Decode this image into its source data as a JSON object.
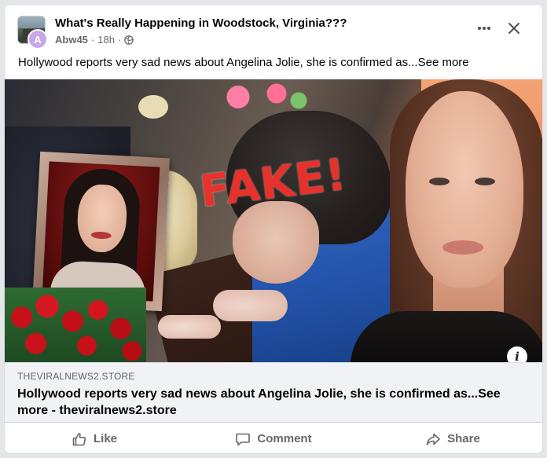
{
  "post": {
    "group_name": "What's Really Happening in Woodstock, Virginia???",
    "author_initial": "A",
    "author": "Abw45",
    "time": "18h",
    "separator": "·",
    "text": "Hollywood reports very sad news about Angelina Jolie, she is confirmed as...",
    "see_more": "See more"
  },
  "link_preview": {
    "stamp_text": "FAKE!",
    "domain": "THEVIRALNEWS2.STORE",
    "title": "Hollywood reports very sad news about Angelina Jolie, she is confirmed as...See more - theviralnews2.store",
    "info_icon": "i"
  },
  "actions": {
    "like": "Like",
    "comment": "Comment",
    "share": "Share"
  },
  "icons": {
    "more": "more-horizontal-icon",
    "close": "close-icon",
    "privacy": "globe-icon",
    "like": "thumbs-up-icon",
    "comment": "comment-bubble-icon",
    "share": "share-arrow-icon"
  },
  "colors": {
    "stamp": "#e8312a",
    "secondary_text": "#65676b",
    "avatar": "#c9a6e6"
  }
}
